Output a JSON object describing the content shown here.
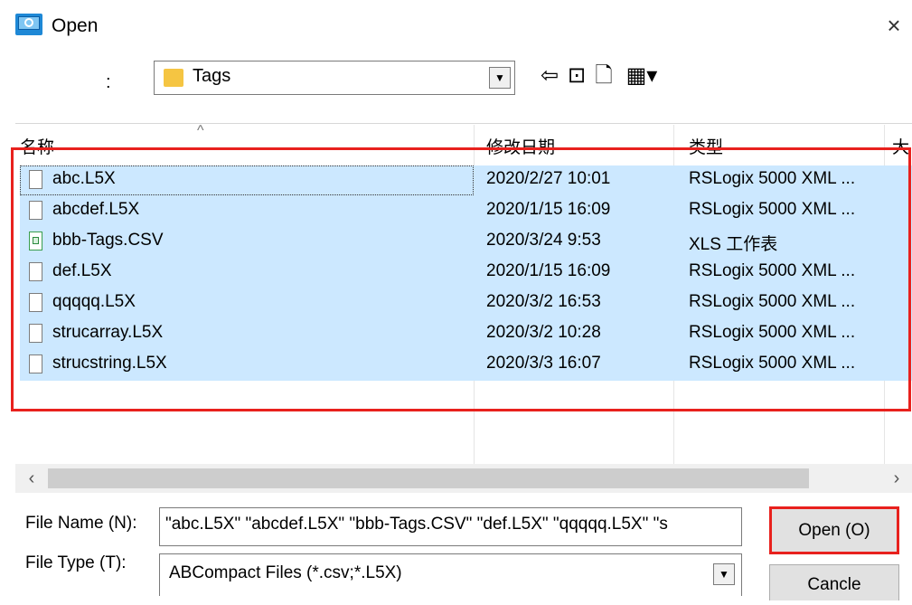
{
  "window": {
    "title": "Open",
    "close_glyph": "×"
  },
  "look_in": {
    "label": ":",
    "value": "Tags"
  },
  "toolbar": [
    {
      "name": "back-icon",
      "glyph": "⇦"
    },
    {
      "name": "up-folder-icon",
      "glyph": "⊡"
    },
    {
      "name": "new-folder-icon",
      "glyph": "🗋"
    },
    {
      "name": "view-menu-icon",
      "glyph": "▦▾"
    }
  ],
  "columns": {
    "name": "名称",
    "date": "修改日期",
    "type": "类型",
    "size": "大"
  },
  "files": [
    {
      "name": "abc.L5X",
      "date": "2020/2/27 10:01",
      "type": "RSLogix 5000 XML ...",
      "icon": "document-icon"
    },
    {
      "name": "abcdef.L5X",
      "date": "2020/1/15 16:09",
      "type": "RSLogix 5000 XML ...",
      "icon": "document-icon"
    },
    {
      "name": "bbb-Tags.CSV",
      "date": "2020/3/24 9:53",
      "type": "XLS 工作表",
      "icon": "spreadsheet-icon"
    },
    {
      "name": "def.L5X",
      "date": "2020/1/15 16:09",
      "type": "RSLogix 5000 XML ...",
      "icon": "document-icon"
    },
    {
      "name": "qqqqq.L5X",
      "date": "2020/3/2 16:53",
      "type": "RSLogix 5000 XML ...",
      "icon": "document-icon"
    },
    {
      "name": "strucarray.L5X",
      "date": "2020/3/2 10:28",
      "type": "RSLogix 5000 XML ...",
      "icon": "document-icon"
    },
    {
      "name": "strucstring.L5X",
      "date": "2020/3/3 16:07",
      "type": "RSLogix 5000 XML ...",
      "icon": "document-icon"
    }
  ],
  "file_name": {
    "label": "File Name  (N):",
    "value": "\"abc.L5X\" \"abcdef.L5X\" \"bbb-Tags.CSV\" \"def.L5X\" \"qqqqq.L5X\" \"s"
  },
  "file_type": {
    "label": "File Type   (T):",
    "value": "ABCompact Files (*.csv;*.L5X)"
  },
  "buttons": {
    "open": "Open (O)",
    "cancel": "Cancle"
  },
  "colors": {
    "selection": "#cce8ff",
    "highlight_border": "#e8211d"
  }
}
